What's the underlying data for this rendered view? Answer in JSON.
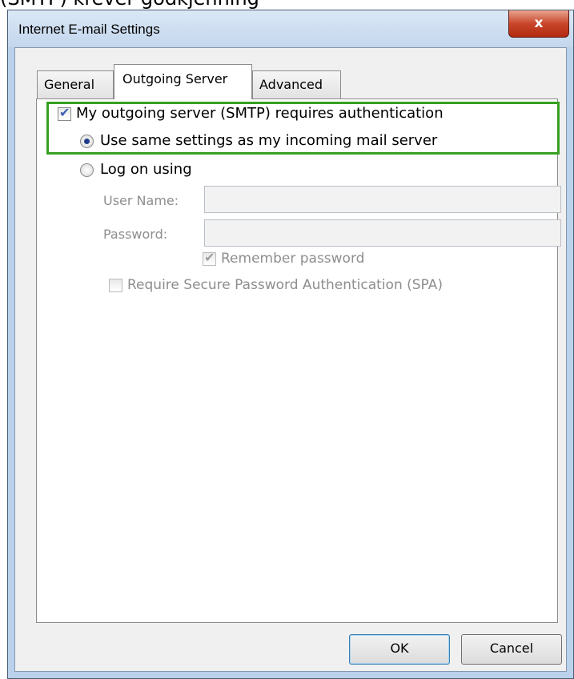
{
  "caption": "(SMTP) krever godkjenning",
  "window": {
    "title": "Internet E-mail Settings",
    "close_glyph": "x"
  },
  "tabs": [
    {
      "label": "General",
      "active": false
    },
    {
      "label": "Outgoing Server",
      "active": true
    },
    {
      "label": "Advanced",
      "active": false
    }
  ],
  "outgoing": {
    "requires_auth_label": "My outgoing server (SMTP) requires authentication",
    "requires_auth_checked": true,
    "same_settings_label": "Use same settings as my incoming mail server",
    "same_settings_selected": true,
    "log_on_label": "Log on using",
    "log_on_selected": false,
    "username_label": "User Name:",
    "username_value": "",
    "password_label": "Password:",
    "password_value": "",
    "remember_label": "Remember password",
    "remember_checked": true,
    "spa_label": "Require Secure Password Authentication (SPA)",
    "spa_checked": false
  },
  "buttons": {
    "ok": "OK",
    "cancel": "Cancel"
  },
  "colors": {
    "highlight": "#37a022",
    "close_button": "#c8462b",
    "frame": "#b9d1ea"
  }
}
